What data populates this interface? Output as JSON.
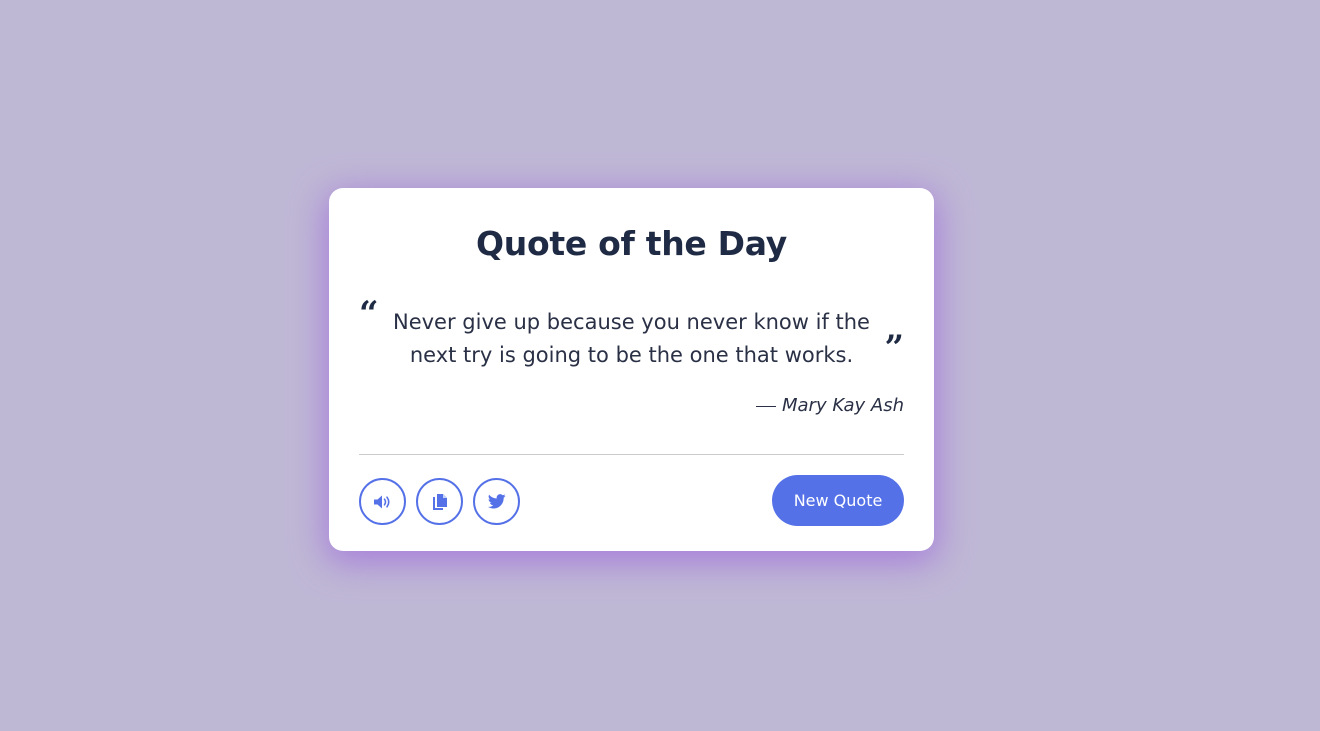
{
  "card": {
    "title": "Quote of the Day",
    "quote": "Never give up because you never know if the next try is going to be the one that works.",
    "author": "Mary Kay Ash",
    "open_quote_glyph": "“",
    "close_quote_glyph": "”"
  },
  "actions": {
    "icons": [
      "speaker-icon",
      "copy-icon",
      "twitter-icon"
    ],
    "new_quote_label": "New Quote"
  },
  "colors": {
    "background": "#bfb8d5",
    "card": "#ffffff",
    "accent": "#5571e8",
    "text": "#1f2a44",
    "shadow_glow": "#a06edc"
  }
}
